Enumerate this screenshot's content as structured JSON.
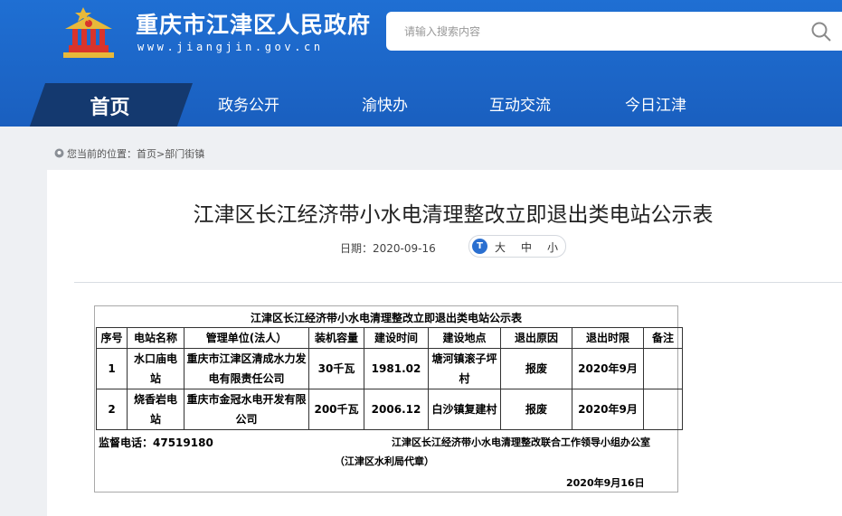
{
  "header": {
    "site_title": "重庆市江津区人民政府",
    "site_domain": "www.jiangjin.gov.cn",
    "search_placeholder": "请输入搜索内容"
  },
  "nav": {
    "home": "首页",
    "items": [
      "政务公开",
      "渝快办",
      "互动交流",
      "今日江津"
    ]
  },
  "breadcrumb": {
    "prefix": "您当前的位置：",
    "links": [
      "首页",
      "部门街镇"
    ],
    "separator": ">"
  },
  "article": {
    "title": "江津区长江经济带小水电清理整改立即退出类电站公示表",
    "date_label": "日期：",
    "date": "2020-09-16",
    "font_sizes": [
      "大",
      "中",
      "小"
    ]
  },
  "notice_table": {
    "title": "江津区长江经济带小水电清理整改立即退出类电站公示表",
    "headers": [
      "序号",
      "电站名称",
      "管理单位(法人）",
      "装机容量",
      "建设时间",
      "建设地点",
      "退出原因",
      "退出时限",
      "备注"
    ],
    "rows": [
      {
        "no": "1",
        "name": "水口庙电站",
        "unit": "重庆市江津区清成水力发电有限责任公司",
        "capacity": "30千瓦",
        "built": "1981.02",
        "location": "塘河镇滚子坪村",
        "reason": "报废",
        "deadline": "2020年9月",
        "remark": ""
      },
      {
        "no": "2",
        "name": "烧香岩电站",
        "unit": "重庆市金冠水电开发有限公司",
        "capacity": "200千瓦",
        "built": "2006.12",
        "location": "白沙镇复建村",
        "reason": "报废",
        "deadline": "2020年9月",
        "remark": ""
      }
    ],
    "phone": "监督电话：47519180",
    "office": "江津区长江经济带小水电清理整改联合工作领导小组办公室",
    "seal": "（江津区水利局代章）",
    "sign_date": "2020年9月16日"
  },
  "colors": {
    "header_blue": "#1a5fbf",
    "nav_active": "#14396f",
    "page_bg": "#eef0f3"
  }
}
